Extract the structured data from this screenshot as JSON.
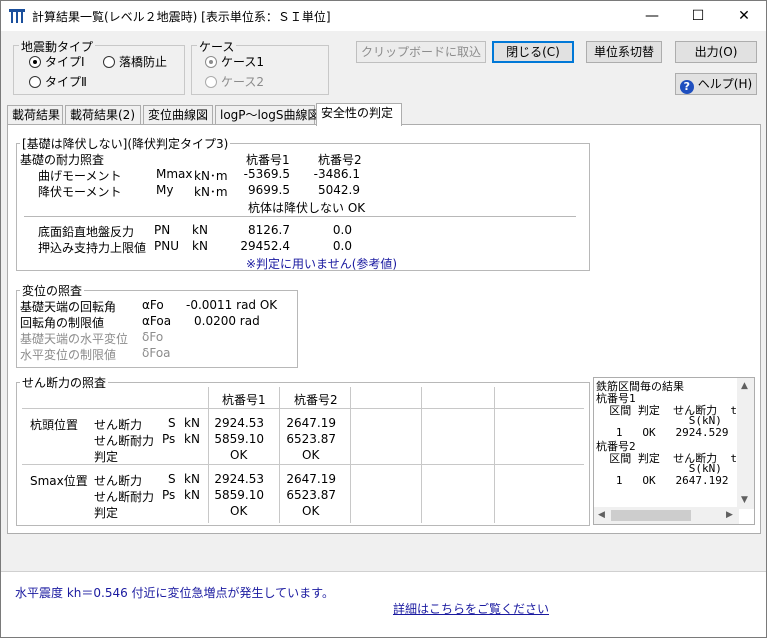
{
  "window": {
    "title": "計算結果一覧(レベル２地震時) [表示単位系：ＳＩ単位]",
    "minimize": "—",
    "maximize": "☐",
    "close": "✕"
  },
  "quake_type": {
    "title": "地震動タイプ",
    "options": [
      "タイプⅠ",
      "落橋防止",
      "タイプⅡ"
    ]
  },
  "case": {
    "title": "ケース",
    "options": [
      "ケース1",
      "ケース2"
    ]
  },
  "buttons": {
    "clipboard": "クリップボードに取込",
    "close": "閉じる(C)",
    "unit_switch": "単位系切替",
    "output": "出力(O)",
    "help": "ヘルプ(H)"
  },
  "tabs": [
    "載荷結果",
    "載荷結果(2)",
    "変位曲線図",
    "logP～logS曲線図",
    "安全性の判定"
  ],
  "foundation": {
    "title": "[基礎は降伏しない](降伏判定タイプ3)",
    "section_label": "基礎の耐力照査",
    "col1": "杭番号1",
    "col2": "杭番号2",
    "rows": [
      {
        "label": "曲げモーメント",
        "sym": "Mmax",
        "unit": "kN･m",
        "v1": "-5369.5",
        "v2": "-3486.1"
      },
      {
        "label": "降伏モーメント",
        "sym": "My",
        "unit": "kN･m",
        "v1": "9699.5",
        "v2": "5042.9"
      }
    ],
    "judgement": "杭体は降伏しない  OK",
    "rows2": [
      {
        "label": "底面鉛直地盤反力",
        "sym": "PN",
        "unit": "kN",
        "v1": "8126.7",
        "v2": "0.0"
      },
      {
        "label": "押込み支持力上限値",
        "sym": "PNU",
        "unit": "kN",
        "v1": "29452.4",
        "v2": "0.0"
      }
    ],
    "note": "※判定に用いません(参考値)"
  },
  "displacement": {
    "title": "変位の照査",
    "rows": [
      {
        "label": "基礎天端の回転角",
        "sym": "αFo",
        "value": "-0.0011 rad OK",
        "disabled": false
      },
      {
        "label": "回転角の制限値",
        "sym": "αFoa",
        "value": "0.0200 rad",
        "disabled": false
      },
      {
        "label": "基礎天端の水平変位",
        "sym": "δFo",
        "value": "",
        "disabled": true
      },
      {
        "label": "水平変位の制限値",
        "sym": "δFoa",
        "value": "",
        "disabled": true
      }
    ]
  },
  "shear": {
    "title": "せん断力の照査",
    "col1": "杭番号1",
    "col2": "杭番号2",
    "groups": [
      {
        "pos": "杭頭位置",
        "rows": [
          {
            "label": "せん断力",
            "sym": "S",
            "unit": "kN",
            "v1": "2924.53",
            "v2": "2647.19"
          },
          {
            "label": "せん断耐力",
            "sym": "Ps",
            "unit": "kN",
            "v1": "5859.10",
            "v2": "6523.87"
          },
          {
            "label": "判定",
            "sym": "",
            "unit": "",
            "v1": "OK",
            "v2": "OK"
          }
        ]
      },
      {
        "pos": "Smax位置",
        "rows": [
          {
            "label": "せん断力",
            "sym": "S",
            "unit": "kN",
            "v1": "2924.53",
            "v2": "2647.19"
          },
          {
            "label": "せん断耐力",
            "sym": "Ps",
            "unit": "kN",
            "v1": "5859.10",
            "v2": "6523.87"
          },
          {
            "label": "判定",
            "sym": "",
            "unit": "",
            "v1": "OK",
            "v2": "OK"
          }
        ]
      }
    ]
  },
  "rebar_list": {
    "lines": [
      "鉄筋区間毎の結果",
      "杭番号1",
      "  区間 判定  せん断力  t",
      "              S(kN)",
      "   1   OK   2924.529",
      "杭番号2",
      "  区間 判定  せん断力  t",
      "              S(kN)",
      "   1   OK   2647.192"
    ]
  },
  "status": {
    "message": "水平震度 kh＝0.546 付近に変位急増点が発生しています。",
    "link": "詳細はこちらをご覧ください"
  }
}
